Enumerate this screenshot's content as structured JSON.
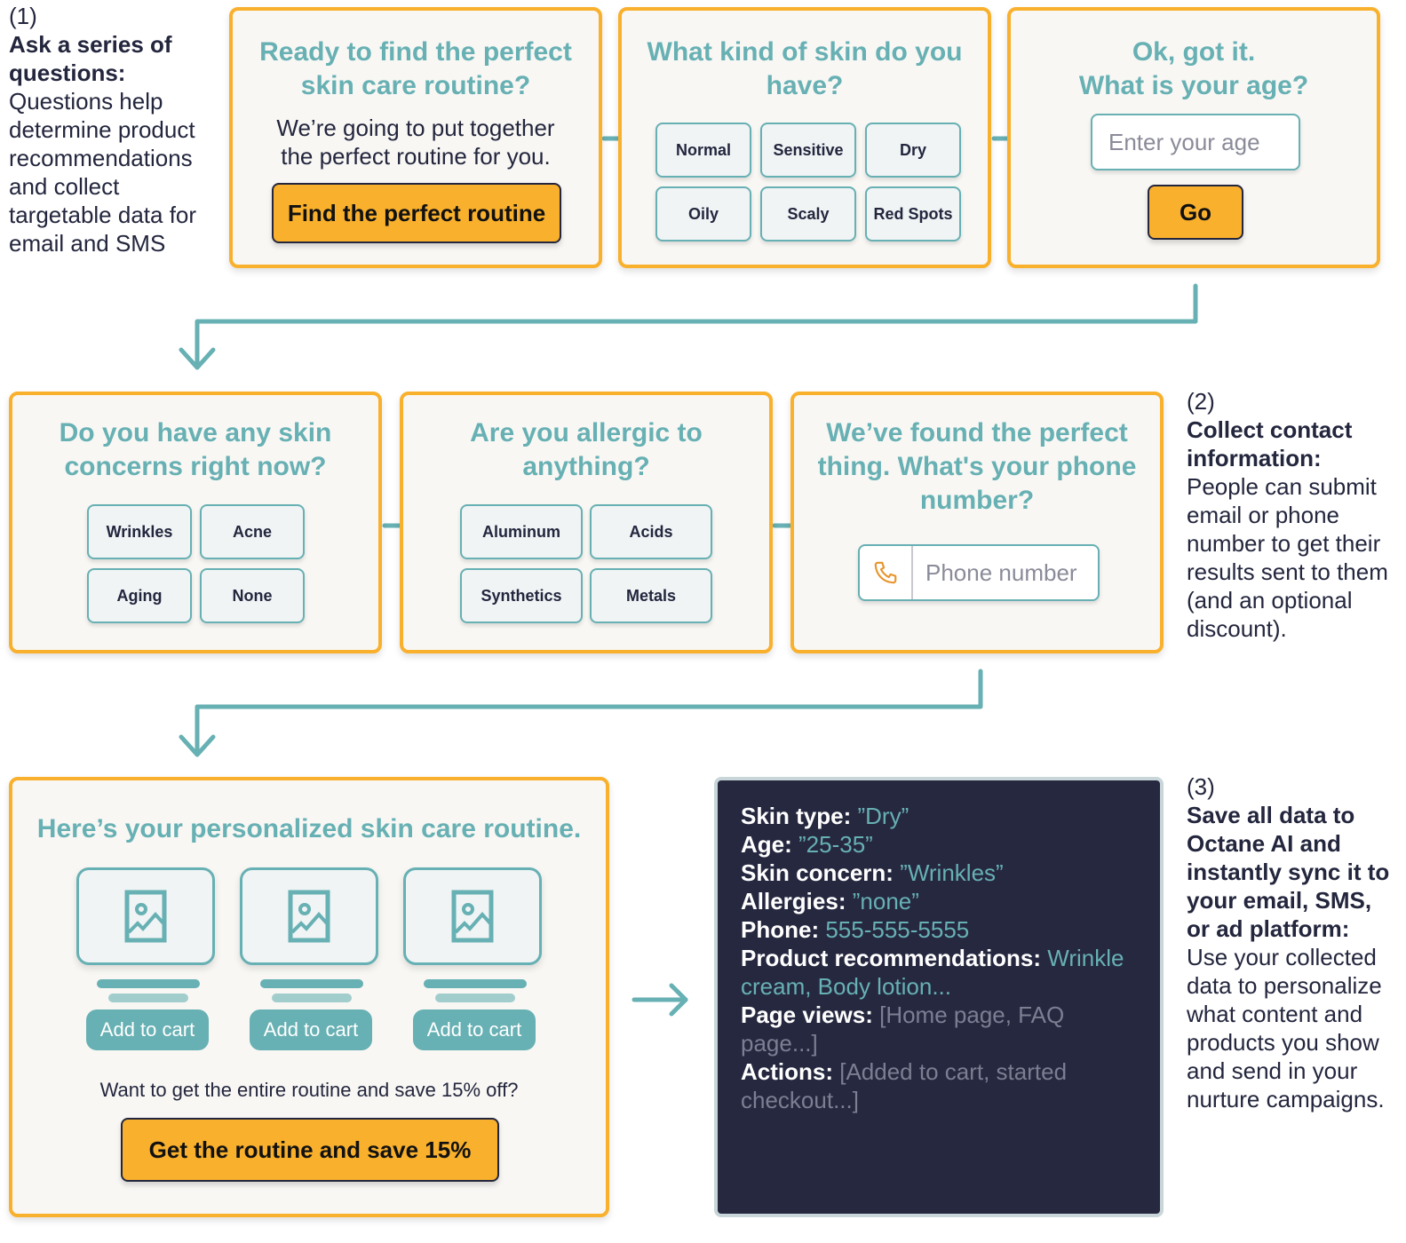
{
  "colors": {
    "accent_teal": "#67b0b3",
    "accent_yellow": "#f9b02c",
    "text_dark": "#23263d",
    "panel_dark": "#262840"
  },
  "notes": [
    {
      "step": "(1)",
      "title": "Ask a series of questions:",
      "body": "Questions help determine product recommendations and collect targetable data for email and SMS"
    },
    {
      "step": "(2)",
      "title": "Collect contact information:",
      "body": "People can submit email or phone number to get their results sent to them (and an optional discount)."
    },
    {
      "step": "(3)",
      "title": "Save all data to Octane AI and instantly sync it to your email, SMS, or ad platform:",
      "body": "Use your collected data to personalize what content and products you show and send in your nurture campaigns."
    }
  ],
  "card_intro": {
    "title": "Ready to find the perfect skin care routine?",
    "subtitle": "We’re going to put together the perfect routine for you.",
    "button": "Find the perfect routine"
  },
  "card_skin": {
    "title": "What kind of skin do you have?",
    "options": [
      "Normal",
      "Sensitive",
      "Dry",
      "Oily",
      "Scaly",
      "Red Spots"
    ]
  },
  "card_age": {
    "title_line1": "Ok, got it.",
    "title_line2": "What is your age?",
    "placeholder": "Enter your age",
    "button": "Go"
  },
  "card_concerns": {
    "title": "Do you have any skin concerns right now?",
    "options": [
      "Wrinkles",
      "Acne",
      "Aging",
      "None"
    ]
  },
  "card_allergy": {
    "title": "Are you allergic to anything?",
    "options": [
      "Aluminum",
      "Acids",
      "Synthetics",
      "Metals"
    ]
  },
  "card_phone": {
    "title": "We’ve found the perfect thing. What's your phone number?",
    "placeholder": "Phone number",
    "icon": "phone-icon"
  },
  "card_results": {
    "title": "Here’s your personalized skin care routine.",
    "products": [
      {
        "icon": "image-placeholder-icon",
        "button": "Add to cart"
      },
      {
        "icon": "image-placeholder-icon",
        "button": "Add to cart"
      },
      {
        "icon": "image-placeholder-icon",
        "button": "Add to cart"
      }
    ],
    "offer_text": "Want to get the entire routine and save 15% off?",
    "offer_button": "Get the routine and save 15%"
  },
  "data_panel": {
    "rows": [
      {
        "key": "Skin type:",
        "value": "”Dry”",
        "style": "v"
      },
      {
        "key": "Age:",
        "value": "”25-35”",
        "style": "v"
      },
      {
        "key": "Skin concern:",
        "value": "”Wrinkles”",
        "style": "v"
      },
      {
        "key": "Allergies:",
        "value": "”none”",
        "style": "v"
      },
      {
        "key": "Phone:",
        "value": "555-555-5555",
        "style": "v"
      },
      {
        "key": "Product recommendations:",
        "value": "Wrinkle cream, Body lotion...",
        "style": "v"
      },
      {
        "key": "Page views:",
        "value": "[Home page, FAQ page...]",
        "style": "g"
      },
      {
        "key": "Actions:",
        "value": "[Added to cart, started checkout...]",
        "style": "g"
      }
    ]
  }
}
